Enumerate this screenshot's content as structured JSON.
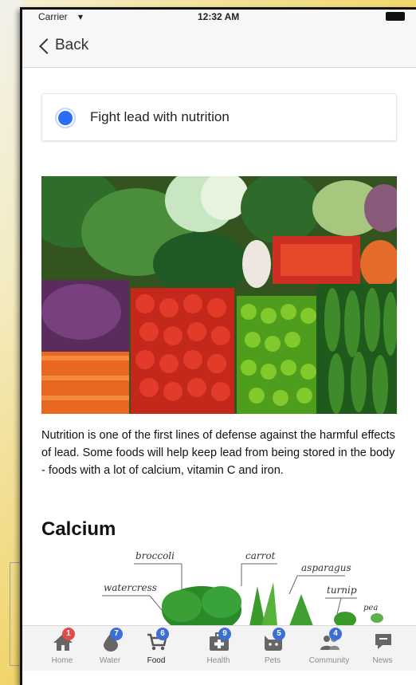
{
  "status_bar": {
    "carrier": "Carrier",
    "time": "12:32 AM"
  },
  "nav": {
    "back_label": "Back"
  },
  "option": {
    "label": "Fight lead with nutrition",
    "selected": true
  },
  "intro_text": "Nutrition is one of the first lines of defense against the harmful effects of lead. Some foods will help keep lead from being stored in the body - foods with a lot of calcium, vitamin C and iron.",
  "section_title": "Calcium",
  "illustration_labels": {
    "broccoli": "broccoli",
    "carrot": "carrot",
    "asparagus": "asparagus",
    "watercress": "watercress",
    "turnip": "turnip",
    "pea": "pea"
  },
  "tabs": [
    {
      "label": "Home",
      "badge": "1",
      "badge_color": "#e24a4a",
      "icon": "home-icon"
    },
    {
      "label": "Water",
      "badge": "7",
      "badge_color": "#3b6fd6",
      "icon": "water-drop-icon"
    },
    {
      "label": "Food",
      "badge": "6",
      "badge_color": "#3b6fd6",
      "icon": "cart-icon",
      "active": true
    },
    {
      "label": "Health",
      "badge": "9",
      "badge_color": "#3b6fd6",
      "icon": "medical-kit-icon"
    },
    {
      "label": "Pets",
      "badge": "5",
      "badge_color": "#3b6fd6",
      "icon": "cat-icon"
    },
    {
      "label": "Community",
      "badge": "4",
      "badge_color": "#3b6fd6",
      "icon": "people-icon"
    },
    {
      "label": "News",
      "badge": "",
      "icon": "chat-bubble-icon"
    }
  ],
  "colors": {
    "accent": "#2b6ef5",
    "badge_blue": "#3b6fd6",
    "badge_red": "#e24a4a"
  }
}
